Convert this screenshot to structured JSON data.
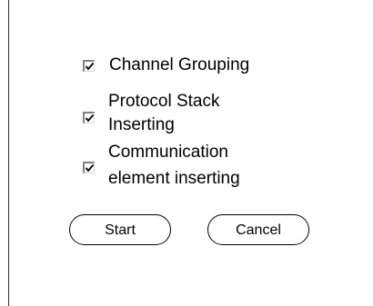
{
  "options": [
    {
      "line1": "Channel Grouping",
      "line2": "",
      "checked": true
    },
    {
      "line1": "Protocol Stack",
      "line2": "Inserting",
      "checked": true
    },
    {
      "line1": "Communication",
      "line2": "element inserting",
      "checked": true
    }
  ],
  "buttons": {
    "start_label": "Start",
    "cancel_label": "Cancel"
  },
  "colors": {
    "background": "#ffffff",
    "text": "#000000",
    "checkbox_shadow": "#808080"
  }
}
